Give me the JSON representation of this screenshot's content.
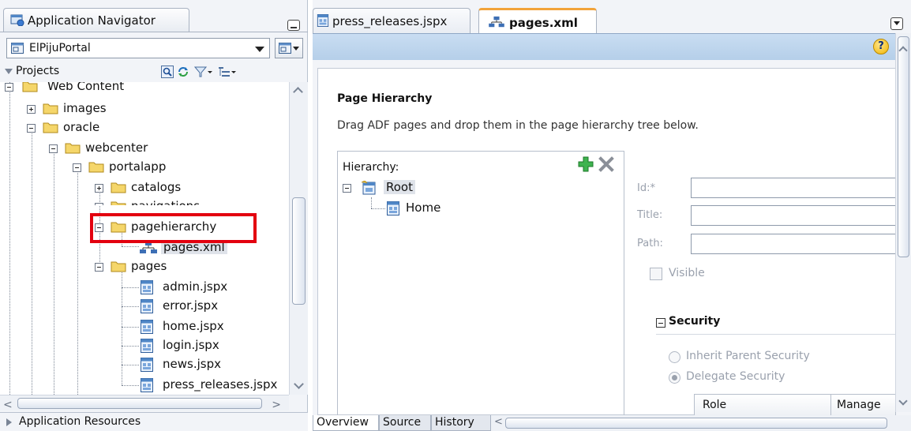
{
  "left_panel": {
    "tab_title": "Application Navigator",
    "app_name": "ElPijuPortal",
    "projects_label": "Projects",
    "tree": [
      {
        "label": "Web Content",
        "type": "folder"
      },
      {
        "label": "images",
        "type": "folder"
      },
      {
        "label": "oracle",
        "type": "folder"
      },
      {
        "label": "webcenter",
        "type": "folder"
      },
      {
        "label": "portalapp",
        "type": "folder"
      },
      {
        "label": "catalogs",
        "type": "folder"
      },
      {
        "label": "navigations",
        "type": "folder"
      },
      {
        "label": "pagehierarchy",
        "type": "folder"
      },
      {
        "label": "pages.xml",
        "type": "xml-file",
        "selected": true
      },
      {
        "label": "pages",
        "type": "folder"
      },
      {
        "label": "admin.jspx",
        "type": "jspx-file"
      },
      {
        "label": "error.jspx",
        "type": "jspx-file"
      },
      {
        "label": "home.jspx",
        "type": "jspx-file"
      },
      {
        "label": "login.jspx",
        "type": "jspx-file"
      },
      {
        "label": "news.jspx",
        "type": "jspx-file"
      },
      {
        "label": "press_releases.jspx",
        "type": "jspx-file"
      }
    ],
    "app_resources_label": "Application Resources",
    "highlight_color": "#e3000f"
  },
  "editor": {
    "tabs": [
      {
        "label": "press_releases.jspx",
        "active": false
      },
      {
        "label": "pages.xml",
        "active": true
      }
    ],
    "help_label": "?",
    "page_hierarchy": {
      "title": "Page Hierarchy",
      "description": "Drag ADF pages and drop them in the page hierarchy tree below.",
      "hierarchy_label": "Hierarchy:",
      "root_label": "Root",
      "child_label": "Home"
    },
    "form": {
      "id_label": "Id:*",
      "title_label": "Title:",
      "path_label": "Path:",
      "visible_label": "Visible",
      "security_label": "Security",
      "inherit_label": "Inherit Parent Security",
      "delegate_label": "Delegate Security",
      "role_header": "Role",
      "manage_header": "Manage"
    },
    "bottom_tabs": [
      "Overview",
      "Source",
      "History"
    ],
    "accent_color": "#f2a33a"
  }
}
